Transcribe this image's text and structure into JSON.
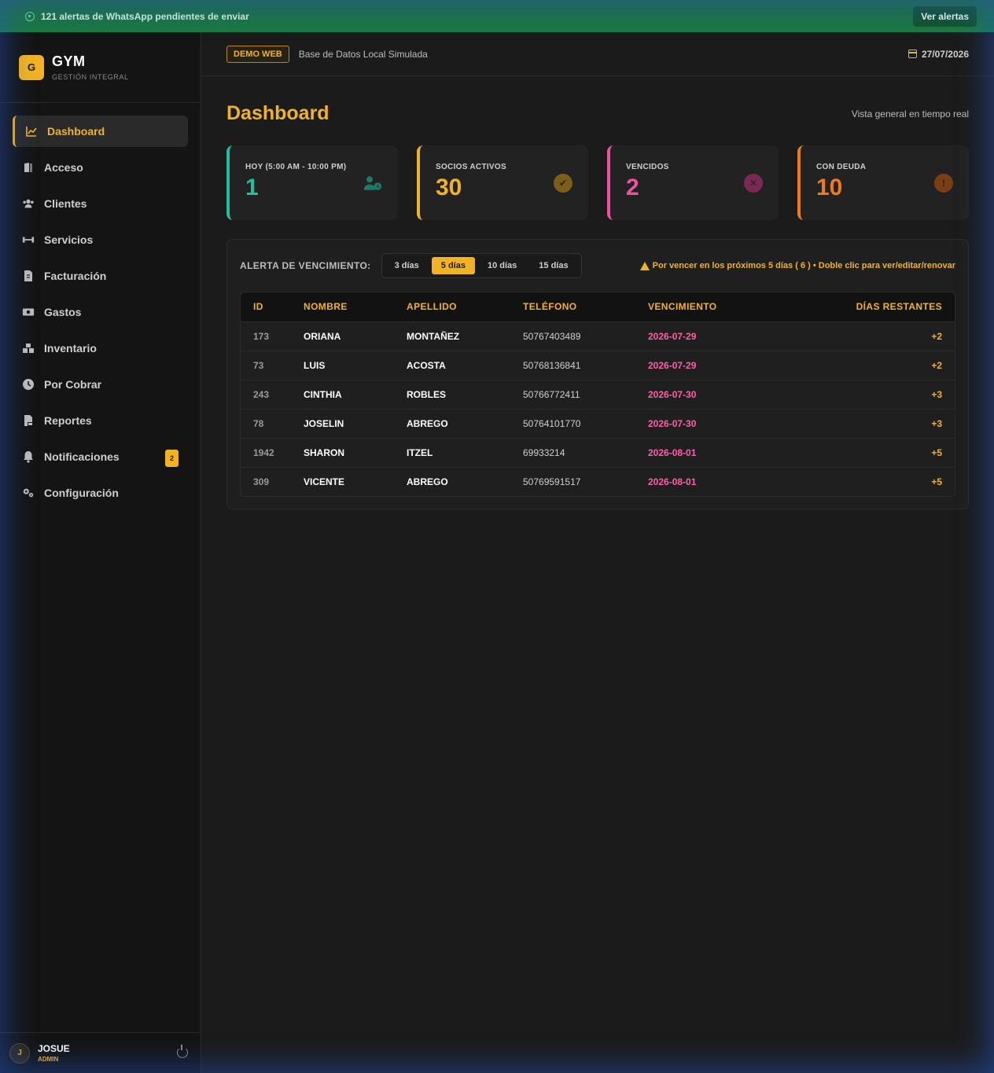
{
  "banner": {
    "message": "121 alertas de WhatsApp pendientes de enviar",
    "button": "Ver alertas"
  },
  "brand": {
    "logo_letter": "G",
    "title": "GYM",
    "subtitle": "GESTIÓN INTEGRAL"
  },
  "sidebar": {
    "items": [
      {
        "label": "Dashboard",
        "icon": "chart-line-icon",
        "active": true
      },
      {
        "label": "Acceso",
        "icon": "door-icon"
      },
      {
        "label": "Clientes",
        "icon": "users-icon"
      },
      {
        "label": "Servicios",
        "icon": "dumbbell-icon"
      },
      {
        "label": "Facturación",
        "icon": "invoice-icon"
      },
      {
        "label": "Gastos",
        "icon": "money-icon"
      },
      {
        "label": "Inventario",
        "icon": "boxes-icon"
      },
      {
        "label": "Por Cobrar",
        "icon": "clock-icon"
      },
      {
        "label": "Reportes",
        "icon": "pdf-file-icon"
      },
      {
        "label": "Notificaciones",
        "icon": "bell-icon",
        "badge": "2"
      },
      {
        "label": "Configuración",
        "icon": "gears-icon"
      }
    ]
  },
  "user": {
    "initial": "J",
    "name": "JOSUE",
    "role": "ADMIN"
  },
  "topbar": {
    "tag": "DEMO WEB",
    "subtitle": "Base de Datos Local Simulada",
    "date": "27/07/2026"
  },
  "page": {
    "title": "Dashboard",
    "subtitle": "Vista general en tiempo real"
  },
  "cards": [
    {
      "label": "HOY (5:00 AM - 10:00 PM)",
      "value": "1",
      "color": "#1fbfa0",
      "icon": "user-clock-icon"
    },
    {
      "label": "SOCIOS ACTIVOS",
      "value": "30",
      "color": "#f2b322",
      "icon": "check-circle-icon"
    },
    {
      "label": "VENCIDOS",
      "value": "2",
      "color": "#f0509e",
      "icon": "x-circle-icon"
    },
    {
      "label": "CON DEUDA",
      "value": "10",
      "color": "#f07a1a",
      "icon": "exclamation-circle-icon"
    }
  ],
  "expiry": {
    "label": "ALERTA DE VENCIMIENTO:",
    "options": [
      "3 días",
      "5 días",
      "10 días",
      "15 días"
    ],
    "selected": "5 días",
    "message": "Por vencer en los próximos 5 días ( 6 ) • Doble clic para ver/editar/renovar"
  },
  "table": {
    "headers": [
      "ID",
      "NOMBRE",
      "APELLIDO",
      "TELÉFONO",
      "VENCIMIENTO",
      "DÍAS RESTANTES"
    ],
    "rows": [
      [
        "173",
        "ORIANA",
        "MONTAÑEZ",
        "50767403489",
        "2026-07-29",
        "+2"
      ],
      [
        "73",
        "LUIS",
        "ACOSTA",
        "50768136841",
        "2026-07-29",
        "+2"
      ],
      [
        "243",
        "CINTHIA",
        "ROBLES",
        "50766772411",
        "2026-07-30",
        "+3"
      ],
      [
        "78",
        "JOSELIN",
        "ABREGO",
        "50764101770",
        "2026-07-30",
        "+3"
      ],
      [
        "1942",
        "SHARON",
        "ITZEL",
        "69933214",
        "2026-08-01",
        "+5"
      ],
      [
        "309",
        "VICENTE",
        "ABREGO",
        "50769591517",
        "2026-08-01",
        "+5"
      ]
    ]
  }
}
